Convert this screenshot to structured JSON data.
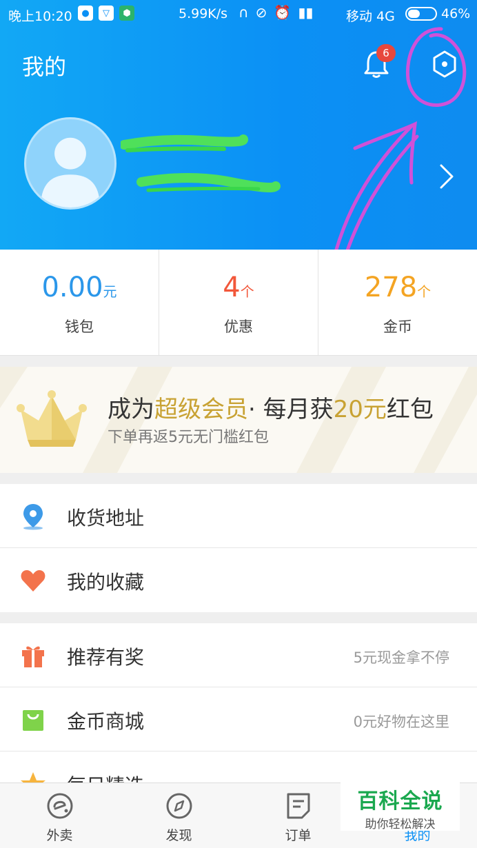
{
  "status_bar": {
    "time": "晚上10:20",
    "speed": "5.99K/s",
    "carrier": "移动 4G",
    "battery_pct": "46%",
    "battery_level": 0.46
  },
  "header": {
    "title": "我的",
    "notification_count": "6"
  },
  "stats": [
    {
      "value": "0.00",
      "unit": "元",
      "label": "钱包",
      "color": "#2b97ea"
    },
    {
      "value": "4",
      "unit": "个",
      "label": "优惠",
      "color": "#f2573a"
    },
    {
      "value": "278",
      "unit": "个",
      "label": "金币",
      "color": "#f4a423"
    }
  ],
  "vip": {
    "title_a": "成为",
    "title_hl1": "超级会员",
    "title_b": "· 每月获",
    "title_hl2": "20元",
    "title_c": "红包",
    "subtitle": "下单再返5元无门槛红包"
  },
  "group1": [
    {
      "label": "收货地址",
      "icon": "location-pin-icon"
    },
    {
      "label": "我的收藏",
      "icon": "heart-icon"
    }
  ],
  "group2": [
    {
      "label": "推荐有奖",
      "hint": "5元现金拿不停",
      "icon": "gift-icon"
    },
    {
      "label": "金币商城",
      "hint": "0元好物在这里",
      "icon": "shopping-bag-icon"
    },
    {
      "label": "每日精选",
      "icon": "star-icon"
    }
  ],
  "tabs": [
    {
      "label": "外卖",
      "icon": "takeout-icon"
    },
    {
      "label": "发现",
      "icon": "compass-icon"
    },
    {
      "label": "订单",
      "icon": "order-icon"
    },
    {
      "label": "我的",
      "icon": "profile-icon"
    }
  ],
  "watermark": {
    "line1": "百科全说",
    "line2": "助你轻松解决"
  },
  "colors": {
    "brand_blue": "#0b90f5",
    "vip_gold": "#c8a233",
    "badge_red": "#e7483d"
  }
}
